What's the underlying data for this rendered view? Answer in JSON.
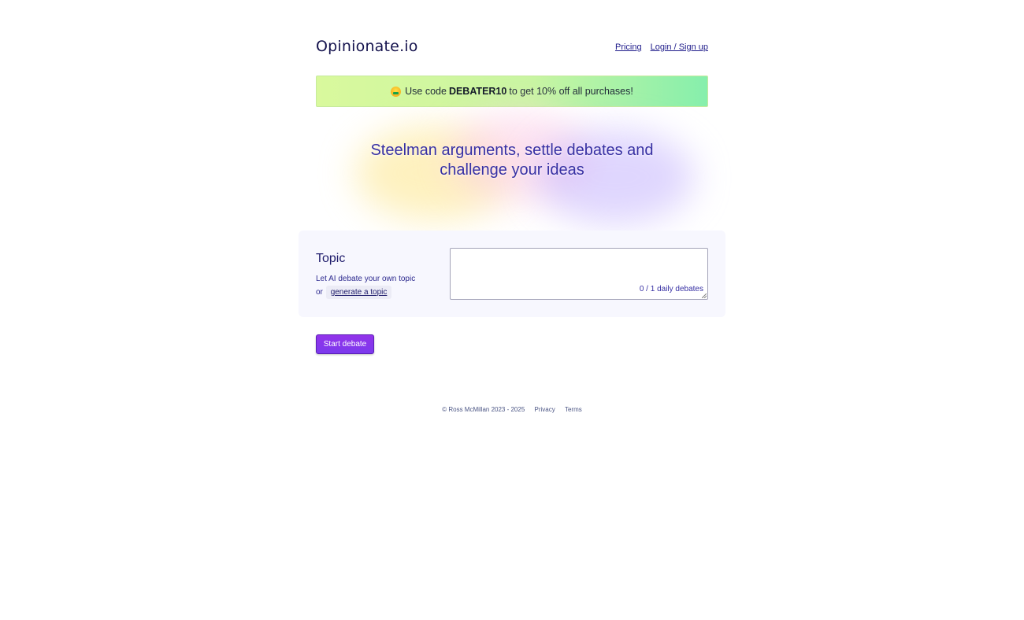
{
  "header": {
    "logo": "Opinionate.io",
    "nav": {
      "pricing": "Pricing",
      "login": "Login / Sign up"
    }
  },
  "promo": {
    "icon": "money-mouth-face-icon",
    "prefix": "Use code",
    "code": "DEBATER10",
    "suffix": "to get 10% off all purchases!"
  },
  "hero": {
    "title_line1": "Steelman arguments, settle debates and",
    "title_line2": "challenge your ideas"
  },
  "topic": {
    "title": "Topic",
    "description": "Let AI debate your own topic",
    "or_text": "or",
    "generate_label": "generate a topic",
    "input_value": "",
    "counter": "0 / 1 daily debates"
  },
  "actions": {
    "start_label": "Start debate"
  },
  "footer": {
    "copyright": "© Ross McMillan 2023 - 2025",
    "privacy": "Privacy",
    "terms": "Terms"
  },
  "colors": {
    "primary": "#7c3aed",
    "heading": "#3730a3",
    "promo_start": "#d9f99d",
    "promo_end": "#86efac"
  }
}
